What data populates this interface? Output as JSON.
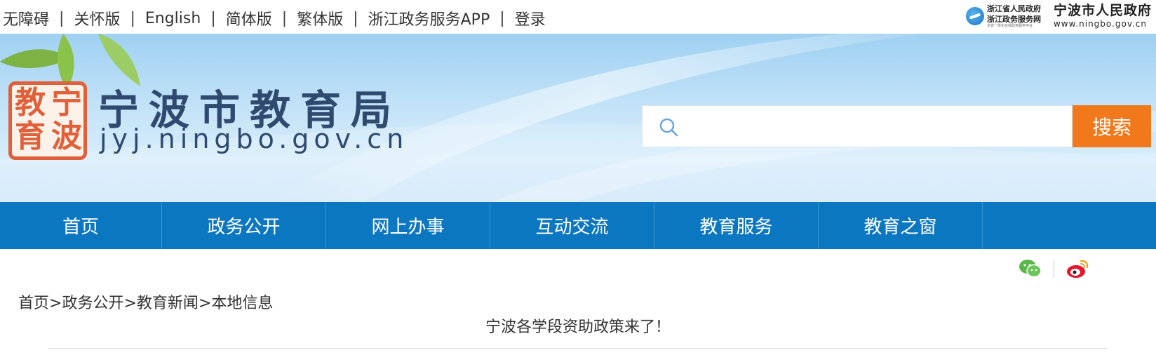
{
  "topbar": {
    "links": [
      "无障碍",
      "关怀版",
      "English",
      "简体版",
      "繁体版",
      "浙江政务服务APP",
      "登录"
    ],
    "separator": "|",
    "zj_logo": {
      "line1": "浙江省人民政府",
      "line2": "浙江政务服务网",
      "line3": "全省一体化在线政务服务平台"
    },
    "nb_logo": {
      "name": "宁波市人民政府",
      "url": "www.ningbo.gov.cn"
    }
  },
  "banner": {
    "seal_chars": [
      "宁",
      "波",
      "教",
      "育"
    ],
    "title": "宁波市教育局",
    "domain": "jyj.ningbo.gov.cn",
    "search": {
      "placeholder": "",
      "button_label": "搜索",
      "icon": "search-icon"
    }
  },
  "nav": {
    "items": [
      "首页",
      "政务公开",
      "网上办事",
      "互动交流",
      "教育服务",
      "教育之窗"
    ]
  },
  "share": {
    "icons": [
      "wechat-icon",
      "weibo-icon"
    ]
  },
  "breadcrumb": {
    "items": [
      "首页",
      "政务公开",
      "教育新闻",
      "本地信息"
    ],
    "separator": ">"
  },
  "article": {
    "title": "宁波各学段资助政策来了！"
  },
  "colors": {
    "nav_bg": "#0b77c1",
    "search_button": "#f2791b",
    "title_text": "#2f4a6e",
    "seal": "#e0603a"
  }
}
